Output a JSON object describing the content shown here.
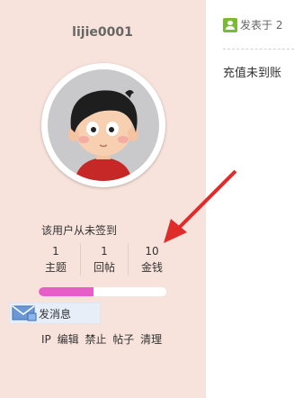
{
  "user": {
    "name": "lijie0001",
    "checkin_status": "该用户从未签到",
    "stats": [
      {
        "value": "1",
        "label": "主题"
      },
      {
        "value": "1",
        "label": "回帖"
      },
      {
        "value": "10",
        "label": "金钱"
      }
    ],
    "progress_fraction": 0.43
  },
  "actions": {
    "send_message": "发消息",
    "admin_links": [
      "IP",
      "编辑",
      "禁止",
      "帖子",
      "清理"
    ]
  },
  "post": {
    "meta": "发表于 2",
    "content": "充值未到账"
  },
  "colors": {
    "sidebar_bg": "#f8e3dc",
    "progress_fill": "#e85ec9",
    "arrow": "#e02b2b",
    "badge": "#7cb83a"
  }
}
